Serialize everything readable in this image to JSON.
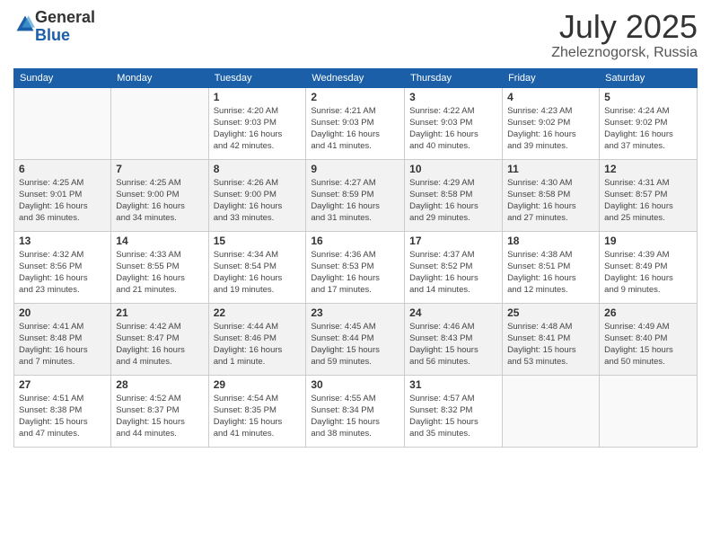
{
  "header": {
    "logo_general": "General",
    "logo_blue": "Blue",
    "month_title": "July 2025",
    "location": "Zheleznogorsk, Russia"
  },
  "days_of_week": [
    "Sunday",
    "Monday",
    "Tuesday",
    "Wednesday",
    "Thursday",
    "Friday",
    "Saturday"
  ],
  "weeks": [
    {
      "days": [
        {
          "num": "",
          "info": ""
        },
        {
          "num": "",
          "info": ""
        },
        {
          "num": "1",
          "info": "Sunrise: 4:20 AM\nSunset: 9:03 PM\nDaylight: 16 hours\nand 42 minutes."
        },
        {
          "num": "2",
          "info": "Sunrise: 4:21 AM\nSunset: 9:03 PM\nDaylight: 16 hours\nand 41 minutes."
        },
        {
          "num": "3",
          "info": "Sunrise: 4:22 AM\nSunset: 9:03 PM\nDaylight: 16 hours\nand 40 minutes."
        },
        {
          "num": "4",
          "info": "Sunrise: 4:23 AM\nSunset: 9:02 PM\nDaylight: 16 hours\nand 39 minutes."
        },
        {
          "num": "5",
          "info": "Sunrise: 4:24 AM\nSunset: 9:02 PM\nDaylight: 16 hours\nand 37 minutes."
        }
      ]
    },
    {
      "days": [
        {
          "num": "6",
          "info": "Sunrise: 4:25 AM\nSunset: 9:01 PM\nDaylight: 16 hours\nand 36 minutes."
        },
        {
          "num": "7",
          "info": "Sunrise: 4:25 AM\nSunset: 9:00 PM\nDaylight: 16 hours\nand 34 minutes."
        },
        {
          "num": "8",
          "info": "Sunrise: 4:26 AM\nSunset: 9:00 PM\nDaylight: 16 hours\nand 33 minutes."
        },
        {
          "num": "9",
          "info": "Sunrise: 4:27 AM\nSunset: 8:59 PM\nDaylight: 16 hours\nand 31 minutes."
        },
        {
          "num": "10",
          "info": "Sunrise: 4:29 AM\nSunset: 8:58 PM\nDaylight: 16 hours\nand 29 minutes."
        },
        {
          "num": "11",
          "info": "Sunrise: 4:30 AM\nSunset: 8:58 PM\nDaylight: 16 hours\nand 27 minutes."
        },
        {
          "num": "12",
          "info": "Sunrise: 4:31 AM\nSunset: 8:57 PM\nDaylight: 16 hours\nand 25 minutes."
        }
      ]
    },
    {
      "days": [
        {
          "num": "13",
          "info": "Sunrise: 4:32 AM\nSunset: 8:56 PM\nDaylight: 16 hours\nand 23 minutes."
        },
        {
          "num": "14",
          "info": "Sunrise: 4:33 AM\nSunset: 8:55 PM\nDaylight: 16 hours\nand 21 minutes."
        },
        {
          "num": "15",
          "info": "Sunrise: 4:34 AM\nSunset: 8:54 PM\nDaylight: 16 hours\nand 19 minutes."
        },
        {
          "num": "16",
          "info": "Sunrise: 4:36 AM\nSunset: 8:53 PM\nDaylight: 16 hours\nand 17 minutes."
        },
        {
          "num": "17",
          "info": "Sunrise: 4:37 AM\nSunset: 8:52 PM\nDaylight: 16 hours\nand 14 minutes."
        },
        {
          "num": "18",
          "info": "Sunrise: 4:38 AM\nSunset: 8:51 PM\nDaylight: 16 hours\nand 12 minutes."
        },
        {
          "num": "19",
          "info": "Sunrise: 4:39 AM\nSunset: 8:49 PM\nDaylight: 16 hours\nand 9 minutes."
        }
      ]
    },
    {
      "days": [
        {
          "num": "20",
          "info": "Sunrise: 4:41 AM\nSunset: 8:48 PM\nDaylight: 16 hours\nand 7 minutes."
        },
        {
          "num": "21",
          "info": "Sunrise: 4:42 AM\nSunset: 8:47 PM\nDaylight: 16 hours\nand 4 minutes."
        },
        {
          "num": "22",
          "info": "Sunrise: 4:44 AM\nSunset: 8:46 PM\nDaylight: 16 hours\nand 1 minute."
        },
        {
          "num": "23",
          "info": "Sunrise: 4:45 AM\nSunset: 8:44 PM\nDaylight: 15 hours\nand 59 minutes."
        },
        {
          "num": "24",
          "info": "Sunrise: 4:46 AM\nSunset: 8:43 PM\nDaylight: 15 hours\nand 56 minutes."
        },
        {
          "num": "25",
          "info": "Sunrise: 4:48 AM\nSunset: 8:41 PM\nDaylight: 15 hours\nand 53 minutes."
        },
        {
          "num": "26",
          "info": "Sunrise: 4:49 AM\nSunset: 8:40 PM\nDaylight: 15 hours\nand 50 minutes."
        }
      ]
    },
    {
      "days": [
        {
          "num": "27",
          "info": "Sunrise: 4:51 AM\nSunset: 8:38 PM\nDaylight: 15 hours\nand 47 minutes."
        },
        {
          "num": "28",
          "info": "Sunrise: 4:52 AM\nSunset: 8:37 PM\nDaylight: 15 hours\nand 44 minutes."
        },
        {
          "num": "29",
          "info": "Sunrise: 4:54 AM\nSunset: 8:35 PM\nDaylight: 15 hours\nand 41 minutes."
        },
        {
          "num": "30",
          "info": "Sunrise: 4:55 AM\nSunset: 8:34 PM\nDaylight: 15 hours\nand 38 minutes."
        },
        {
          "num": "31",
          "info": "Sunrise: 4:57 AM\nSunset: 8:32 PM\nDaylight: 15 hours\nand 35 minutes."
        },
        {
          "num": "",
          "info": ""
        },
        {
          "num": "",
          "info": ""
        }
      ]
    }
  ]
}
